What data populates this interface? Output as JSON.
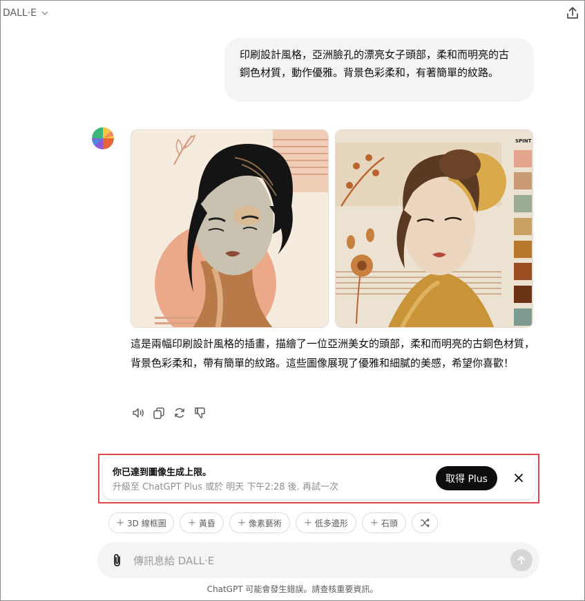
{
  "header": {
    "model_name": "DALL·E"
  },
  "conversation": {
    "user_prompt": "印刷設計風格，亞洲臉孔的漂亮女子頭部，柔和而明亮的古銅色材質，動作優雅。背景色彩柔和，有著簡單的紋路。",
    "image_right_palette_label": "SPINT",
    "reply_text": "這是兩幅印刷設計風格的插畫，描繪了一位亞洲美女的頭部，柔和而明亮的古銅色材質，背景色彩柔和，帶有簡單的紋路。這些圖像展現了優雅和細膩的美感，希望你喜歡！"
  },
  "limit_notice": {
    "title": "你已達到圖像生成上限。",
    "subtitle": "升級至 ChatGPT Plus 或於 明天 下午2:28 後. 再試一次",
    "button_label": "取得 Plus"
  },
  "suggestions": [
    "3D 線框圖",
    "黃昏",
    "像素藝術",
    "低多邊形",
    "石頭"
  ],
  "composer": {
    "placeholder": "傳訊息給 DALL·E"
  },
  "footer": {
    "disclaimer": "ChatGPT 可能會發生錯誤。請查核重要資訊。"
  },
  "colors": {
    "user_bubble_bg": "#f4f4f4",
    "highlight_border": "#e0474c",
    "button_dark": "#0d0d0d",
    "swatches": [
      "#e3a68c",
      "#c89b74",
      "#9aab96",
      "#c9a263",
      "#b8782c",
      "#9a4e22",
      "#6b3416",
      "#7d9a90"
    ]
  },
  "icons": [
    "chevron-down-icon",
    "share-icon",
    "speaker-icon",
    "copy-icon",
    "regenerate-icon",
    "thumbs-down-icon",
    "close-icon",
    "shuffle-icon",
    "paperclip-icon",
    "arrow-up-icon"
  ]
}
